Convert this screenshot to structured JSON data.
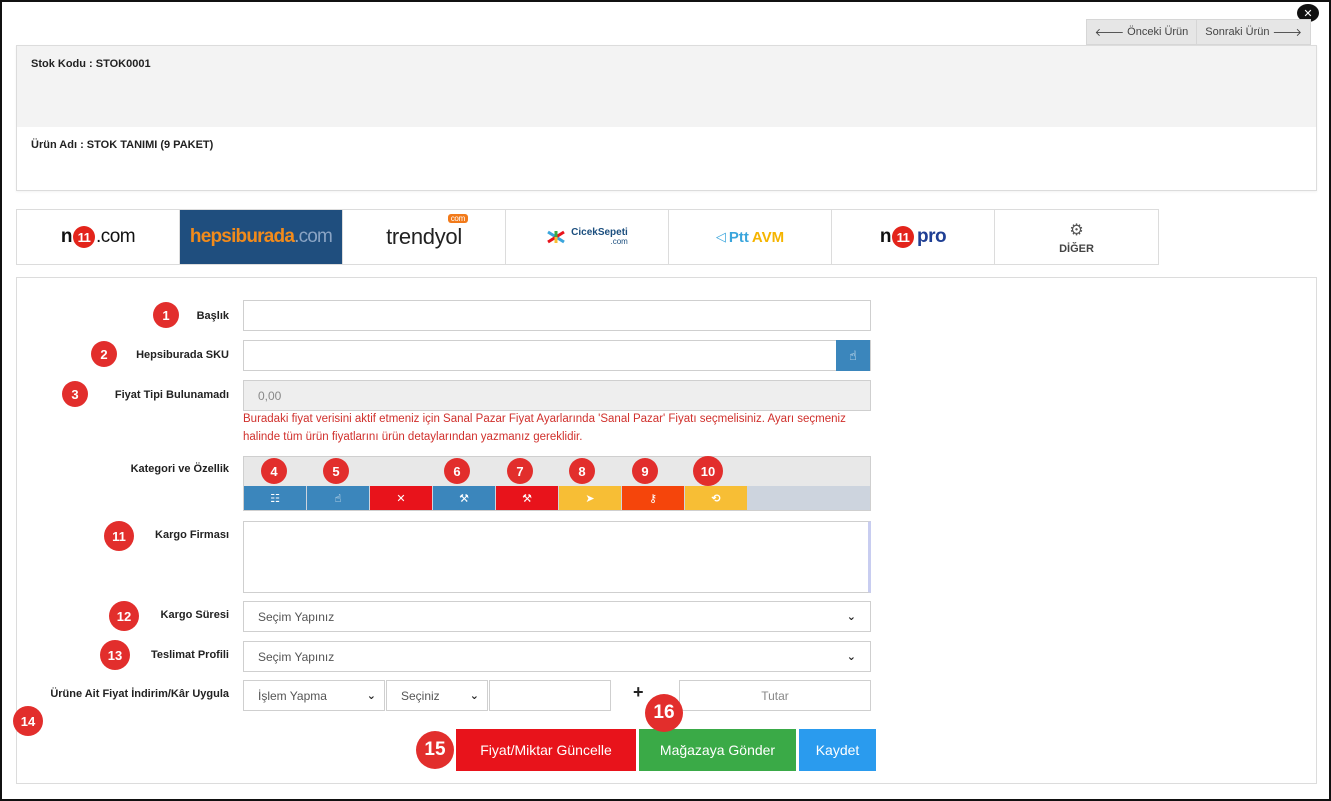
{
  "nav": {
    "prev_label": "Önceki Ürün",
    "next_label": "Sonraki Ürün"
  },
  "info": {
    "stock_code": "Stok Kodu : STOK0001",
    "product_name": "Ürün Adı : STOK TANIMI (9 PAKET)"
  },
  "tabs": [
    {
      "name": "n11.com",
      "active": false
    },
    {
      "name": "hepsiburada.com",
      "active": true
    },
    {
      "name": "trendyol.com",
      "active": false
    },
    {
      "name": "ÇiçekSepeti.com",
      "active": false
    },
    {
      "name": "PttAVM.com",
      "active": false
    },
    {
      "name": "n11pro",
      "active": false
    },
    {
      "name": "DİĞER",
      "active": false
    }
  ],
  "logos": {
    "n11_n": "n",
    "n11_bug": "11",
    "n11_dotcom": ".com",
    "hb_main": "hepsiburada",
    "hb_com": ".com",
    "ty_main": "trendyol",
    "ty_badge": "com",
    "cs_main": "CicekSepeti",
    "cs_com": ".com",
    "ptt_main": "Ptt",
    "ptt_avm": "AVM",
    "pro_n": "n",
    "pro_bug": "11",
    "pro_text": "pro",
    "diger": "DİĞER"
  },
  "form": {
    "baslik_label": "Başlık",
    "baslik_value": "",
    "sku_label": "Hepsiburada SKU",
    "sku_value": "",
    "fiyat_label": "Fiyat Tipi Bulunamadı",
    "fiyat_value": "0,00",
    "fiyat_warning": "Buradaki fiyat verisini aktif etmeniz için Sanal Pazar Fiyat Ayarlarında 'Sanal Pazar' Fiyatı seçmelisiniz. Ayarı seçmeniz halinde tüm ürün fiyatlarını ürün detaylarından yazmanız gereklidir.",
    "kategori_label": "Kategori ve Özellik",
    "kargo_firma_label": "Kargo Firması",
    "kargo_sure_label": "Kargo Süresi",
    "kargo_sure_value": "Seçim Yapınız",
    "teslimat_label": "Teslimat Profili",
    "teslimat_value": "Seçim Yapınız",
    "indirim_label": "Ürüne Ait Fiyat İndirim/Kâr Uygula",
    "islem_value": "İşlem Yapma",
    "secim_value": "Seçiniz",
    "amount_value": "",
    "plus": "+",
    "tutar_placeholder": "Tutar"
  },
  "category_buttons": [
    {
      "icon": "sliders-icon",
      "glyph": "☷",
      "color": "#3b86bc"
    },
    {
      "icon": "hand-pointer-icon",
      "glyph": "☝",
      "color": "#3b86bc"
    },
    {
      "icon": "close-icon",
      "glyph": "✕",
      "color": "#e8131b"
    },
    {
      "icon": "magic-wand-icon",
      "glyph": "⚒",
      "color": "#3b86bc"
    },
    {
      "icon": "magic-wand-icon",
      "glyph": "⚒",
      "color": "#e8131b"
    },
    {
      "icon": "paper-plane-icon",
      "glyph": "➤",
      "color": "#f7be35"
    },
    {
      "icon": "key-icon",
      "glyph": "⚷",
      "color": "#f5450b"
    },
    {
      "icon": "history-icon",
      "glyph": "⟲",
      "color": "#f7be35"
    }
  ],
  "buttons": {
    "update_label": "Fiyat/Miktar Güncelle",
    "send_label": "Mağazaya Gönder",
    "save_label": "Kaydet"
  },
  "markers": [
    "1",
    "2",
    "3",
    "4",
    "5",
    "6",
    "7",
    "8",
    "9",
    "10",
    "11",
    "12",
    "13",
    "14",
    "15",
    "16"
  ],
  "colors": {
    "marker": "#e22e2c",
    "update_btn": "#e8131b",
    "send_btn": "#3aaa47",
    "save_btn": "#2a9bee",
    "hb_tab": "#1f4e7e"
  }
}
